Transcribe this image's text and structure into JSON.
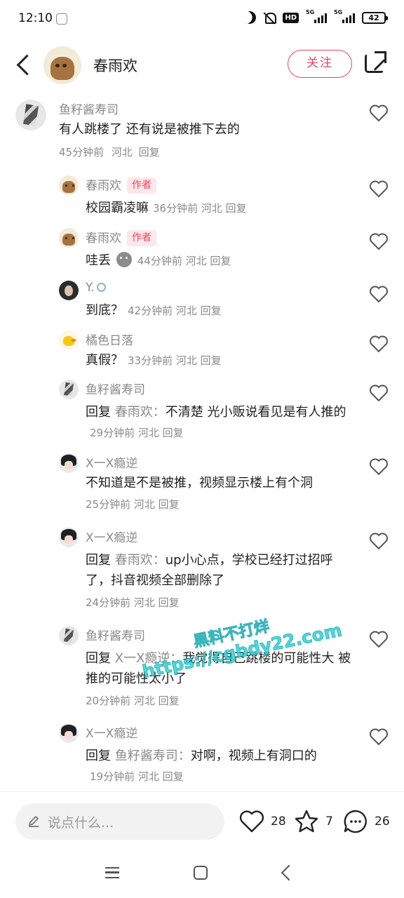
{
  "status_bar": {
    "time": "12:10",
    "hd": "HD",
    "net1": "5G",
    "net2": "5G",
    "battery": "42"
  },
  "header": {
    "name": "春雨欢",
    "follow_label": "关注"
  },
  "comments": [
    {
      "user": "鱼籽酱寿司",
      "text": "有人跳楼了 还有说是被推下去的",
      "time": "45分钟前",
      "location": "河北",
      "reply": "回复"
    },
    {
      "user": "春雨欢",
      "tag": "作者",
      "text": "校园霸凌嘛",
      "time": "36分钟前",
      "location": "河北",
      "reply": "回复"
    },
    {
      "user": "春雨欢",
      "tag": "作者",
      "text": "哇丢",
      "time": "44分钟前",
      "location": "河北",
      "reply": "回复"
    },
    {
      "user": "Y.",
      "text": "到底？",
      "time": "42分钟前",
      "location": "河北",
      "reply": "回复"
    },
    {
      "user": "橘色日落",
      "text": "真假？",
      "time": "33分钟前",
      "location": "河北",
      "reply": "回复"
    },
    {
      "user": "鱼籽酱寿司",
      "reply_word": "回复",
      "reply_to": "春雨欢：",
      "text": "不清楚 光小贩说看见是有人推的",
      "time": "29分钟前",
      "location": "河北",
      "reply": "回复"
    },
    {
      "user": "X一X瘾逆",
      "text": "不知道是不是被推，视频显示楼上有个洞",
      "time": "25分钟前",
      "location": "河北",
      "reply": "回复"
    },
    {
      "user": "X一X瘾逆",
      "reply_word": "回复",
      "reply_to": "春雨欢：",
      "text": "up小心点，学校已经打过招呼了，抖音视频全部删除了",
      "time": "24分钟前",
      "location": "河北",
      "reply": "回复"
    },
    {
      "user": "鱼籽酱寿司",
      "reply_word": "回复",
      "reply_to": "X一X瘾逆：",
      "text": "我觉得自己跳楼的可能性大 被推的可能性太小了",
      "time": "20分钟前",
      "location": "河北",
      "reply": "回复"
    },
    {
      "user": "X一X瘾逆",
      "reply_word": "回复",
      "reply_to": "鱼籽酱寿司：",
      "text": "对啊，视频上有洞口的",
      "time": "19分钟前",
      "location": "河北",
      "reply": "回复"
    }
  ],
  "watermark": {
    "line1": "黑料不打烊",
    "line2": "https://cgbdy22.com"
  },
  "bottom_bar": {
    "placeholder": "说点什么...",
    "likes": "28",
    "stars": "7",
    "comments": "26"
  },
  "icons": [
    "back-icon",
    "share-icon",
    "heart-icon",
    "star-icon",
    "comment-bubble-icon",
    "pen-icon"
  ],
  "colors": {
    "accent": "#e4485f",
    "muted": "#8a8a8a"
  }
}
